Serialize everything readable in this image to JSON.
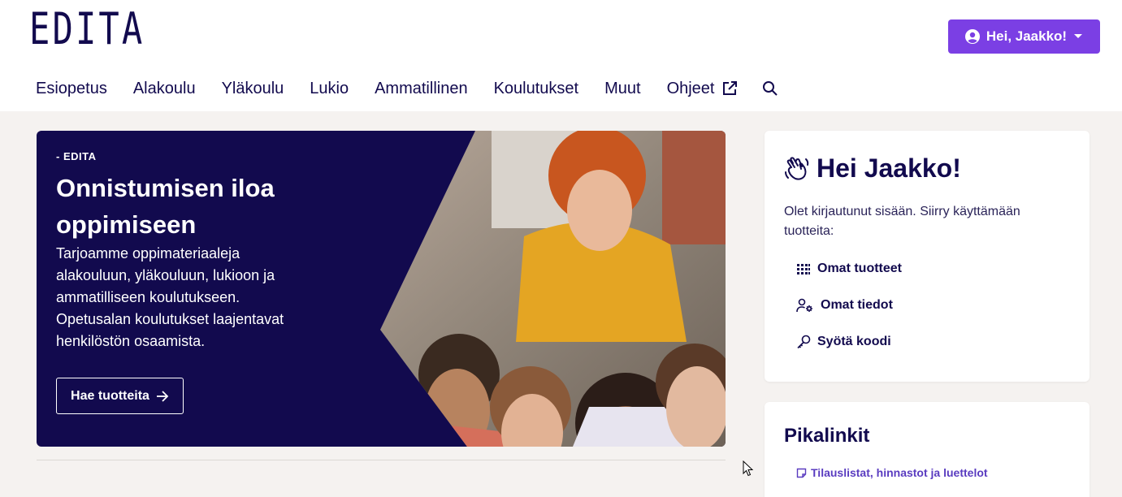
{
  "header": {
    "logo_text": "EDITA",
    "user_button_label": "Hei, Jaakko!",
    "accent_color": "#7b3fe4"
  },
  "nav": {
    "items": [
      {
        "label": "Esiopetus"
      },
      {
        "label": "Alakoulu"
      },
      {
        "label": "Yläkoulu"
      },
      {
        "label": "Lukio"
      },
      {
        "label": "Ammatillinen"
      },
      {
        "label": "Koulutukset"
      },
      {
        "label": "Muut"
      },
      {
        "label": "Ohjeet",
        "icon": "external-link-icon"
      }
    ],
    "search_icon": "search-icon"
  },
  "hero": {
    "kicker": "- EDITA",
    "title": "Onnistumisen iloa oppimiseen",
    "description": "Tarjoamme oppimateriaaleja alakouluun, yläkouluun, lukioon ja ammatilliseen koulutukseen. Opetusalan koulutukset laajentavat henkilöstön osaamista.",
    "button_label": "Hae tuotteita",
    "background_color": "#120a4e"
  },
  "welcome_card": {
    "title": "Hei Jaakko!",
    "text": "Olet kirjautunut sisään. Siirry käyttämään tuotteita:",
    "links": [
      {
        "label": "Omat tuotteet",
        "icon": "grid-icon"
      },
      {
        "label": "Omat tiedot",
        "icon": "user-settings-icon"
      },
      {
        "label": "Syötä koodi",
        "icon": "key-icon"
      }
    ]
  },
  "quick_links_card": {
    "title": "Pikalinkit",
    "links": [
      {
        "label": "Tilauslistat, hinnastot ja luettelot",
        "icon": "note-icon"
      }
    ]
  }
}
